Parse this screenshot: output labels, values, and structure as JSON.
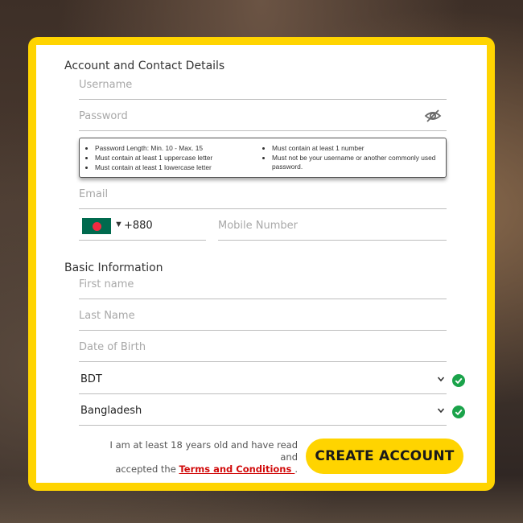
{
  "sections": {
    "account": "Account and Contact Details",
    "basic": "Basic Information"
  },
  "fields": {
    "username_placeholder": "Username",
    "password_placeholder": "Password",
    "email_placeholder": "Email",
    "mobile_placeholder": "Mobile Number",
    "first_name_placeholder": "First name",
    "last_name_placeholder": "Last Name",
    "dob_placeholder": "Date of Birth",
    "currency_value": "BDT",
    "country_value": "Bangladesh"
  },
  "phone": {
    "dial_code": "+880",
    "caret": "▼",
    "flag_icon": "bangladesh-flag"
  },
  "password_rules": {
    "left": [
      "Password Length: Min. 10 - Max. 15",
      "Must contain at least 1 uppercase letter",
      "Must contain at least 1 lowercase letter"
    ],
    "right": [
      "Must contain at least 1 number",
      "Must not be your username or another commonly used password."
    ]
  },
  "terms": {
    "line1": "I am at least 18 years old and have read and",
    "line2_prefix": "accepted the ",
    "link": "Terms and Conditions ",
    "line2_suffix": "."
  },
  "actions": {
    "create_account": "CREATE ACCOUNT"
  },
  "colors": {
    "accent": "#ffd400",
    "link": "#d10b0b",
    "valid": "#1aa34a"
  },
  "icons": {
    "password_toggle": "eye-slash-icon",
    "select_arrow": "chevron-down-icon",
    "valid": "check-circle-icon"
  }
}
